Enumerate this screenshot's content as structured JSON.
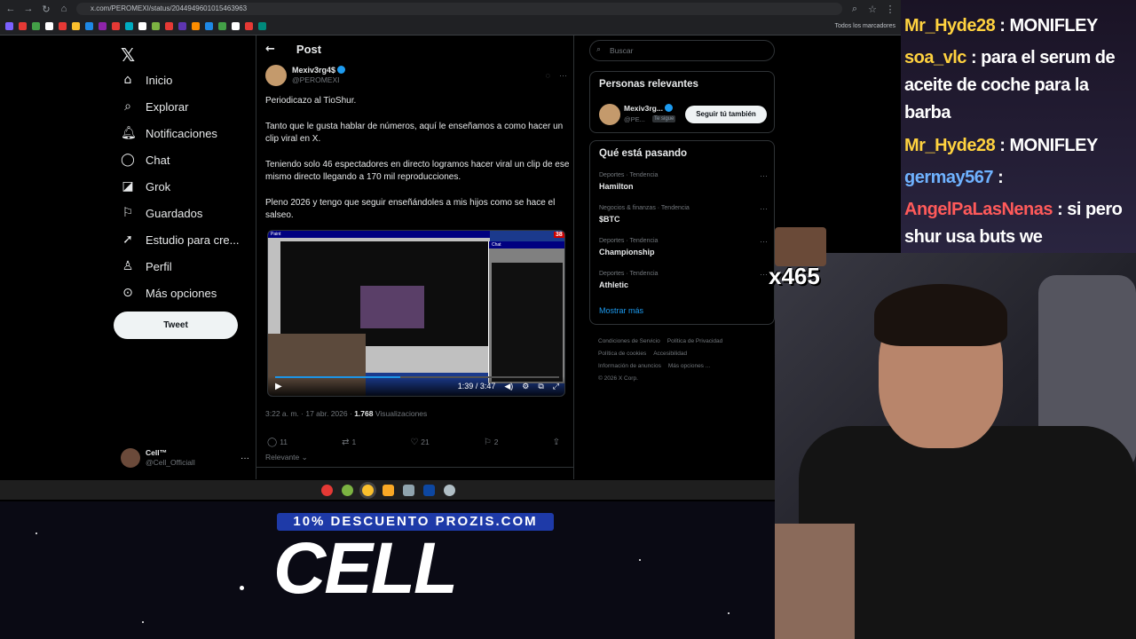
{
  "browser": {
    "url": "x.com/PEROMEXI/status/2044949601015463963",
    "bookmarks_label": "Todos los marcadores"
  },
  "nav": {
    "items": [
      {
        "label": "Inicio",
        "icon": "home-icon"
      },
      {
        "label": "Explorar",
        "icon": "search-icon"
      },
      {
        "label": "Notificaciones",
        "icon": "bell-icon"
      },
      {
        "label": "Chat",
        "icon": "chat-icon"
      },
      {
        "label": "Grok",
        "icon": "grok-icon"
      },
      {
        "label": "Guardados",
        "icon": "bookmark-icon"
      },
      {
        "label": "Estudio para cre...",
        "icon": "rocket-icon"
      },
      {
        "label": "Perfil",
        "icon": "user-icon"
      },
      {
        "label": "Más opciones",
        "icon": "more-icon"
      }
    ],
    "tweet_button": "Tweet",
    "account": {
      "name": "Cell™",
      "handle": "@Cell_Officiall"
    }
  },
  "post": {
    "header": "Post",
    "author_name": "Mexiv3rg4$",
    "author_handle": "@PEROMEXI",
    "paragraphs": [
      "Periodicazo al TioShur.",
      "Tanto que le gusta hablar de números, aquí le enseñamos a como hacer un clip viral en X.",
      "Teniendo solo 46 espectadores en directo logramos hacer viral un clip de ese mismo directo llegando a 170 mil reproducciones.",
      "Pleno 2026 y tengo que seguir enseñándoles a mis hijos como se hace el salseo."
    ],
    "video": {
      "current": "1:39",
      "duration": "3:47",
      "progress": 0.44,
      "badge": "38",
      "paint_title": "Paint",
      "chat_title": "Chat"
    },
    "timestamp": "3:22 a. m. · 17 abr. 2026 ·",
    "views_count": "1.768",
    "views_label": "Visualizaciones",
    "replies": "11",
    "reposts": "1",
    "likes": "21",
    "bookmarks": "2",
    "relevance": "Relevante"
  },
  "right": {
    "search_placeholder": "Buscar",
    "people_title": "Personas relevantes",
    "person_name": "Mexiv3rg...",
    "person_handle": "@PE...",
    "person_badge": "Te sigue",
    "follow_label": "Seguir tú también",
    "trends_title": "Qué está pasando",
    "trends": [
      {
        "category": "Deportes · Tendencia",
        "name": "Hamilton"
      },
      {
        "category": "Negocios & finanzas · Tendencia",
        "name": "$BTC"
      },
      {
        "category": "Deportes · Tendencia",
        "name": "Championship"
      },
      {
        "category": "Deportes · Tendencia",
        "name": "Athletic"
      }
    ],
    "more_label": "Mostrar más",
    "footer_links": [
      "Condiciones de Servicio",
      "Política de Privacidad",
      "Política de cookies",
      "Accesibilidad",
      "Información de anuncios",
      "Más opciones ...",
      "© 2026 X Corp."
    ]
  },
  "stream": {
    "chat": [
      {
        "user": "Mr_Hyde28",
        "text": ": MONIFLEY"
      },
      {
        "user": "soa_vlc",
        "text": ": para el serum de aceite de coche para la barba"
      },
      {
        "user": "Mr_Hyde28",
        "text": ": MONIFLEY"
      },
      {
        "user": "germay567",
        "text": ":"
      },
      {
        "user": "AngelPaLasNenas",
        "text": ": si pero shur usa buts we"
      }
    ],
    "emote_count": "x465",
    "promo": "10% DESCUENTO PROZIS.COM",
    "brand": "CELL"
  }
}
